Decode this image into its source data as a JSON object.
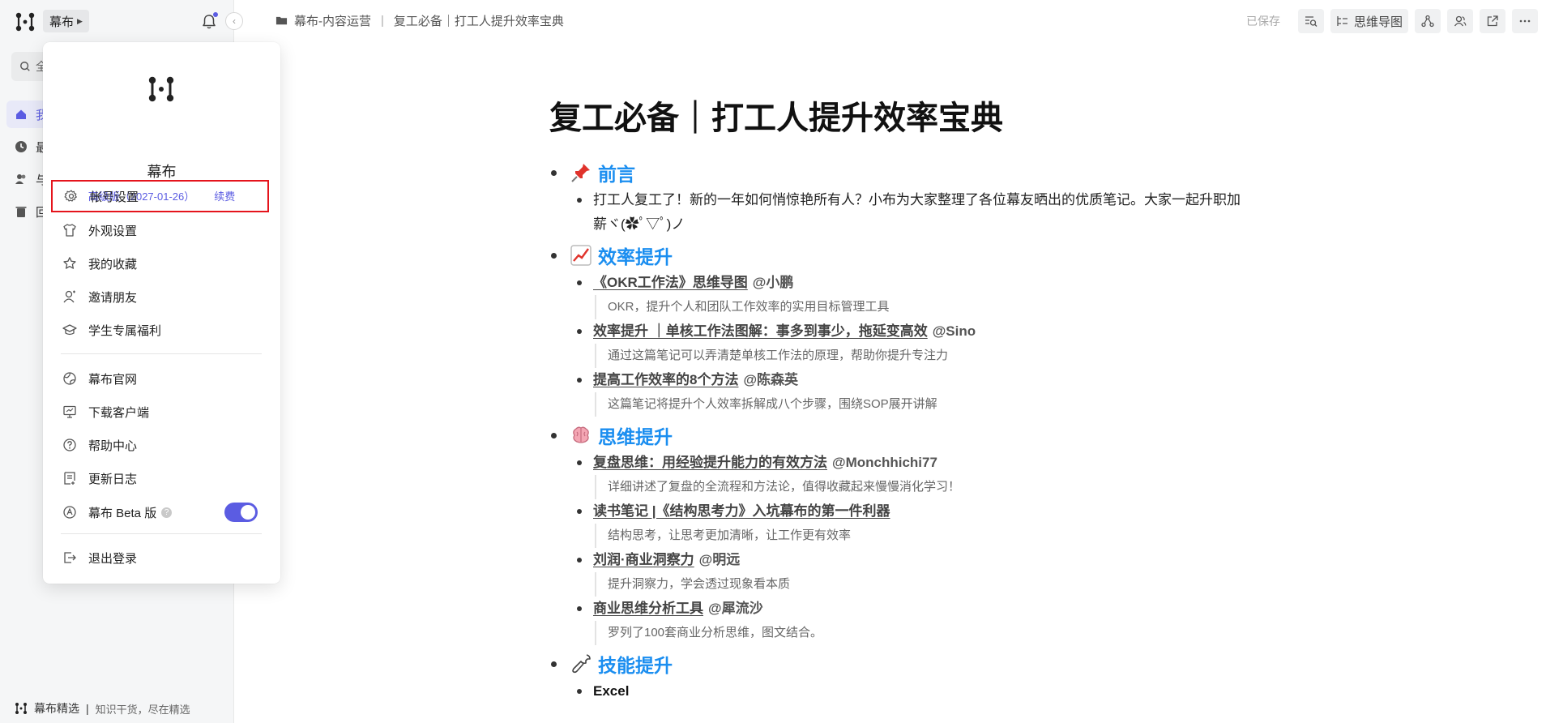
{
  "sidebar": {
    "workspace_label": "幕布",
    "search_label": "全",
    "nav": [
      {
        "label": "我"
      },
      {
        "label": "最"
      },
      {
        "label": "与"
      },
      {
        "label": "回"
      }
    ],
    "footer_brand": "幕布精选",
    "footer_tagline": "知识干货，尽在精选"
  },
  "menu": {
    "name": "幕布",
    "plan": "高级版（2027-01-26）",
    "renew": "续费",
    "items": [
      {
        "label": "帐号设置",
        "icon": "gear-icon"
      },
      {
        "label": "外观设置",
        "icon": "shirt-icon"
      },
      {
        "label": "我的收藏",
        "icon": "star-icon"
      },
      {
        "label": "邀请朋友",
        "icon": "invite-icon"
      },
      {
        "label": "学生专属福利",
        "icon": "graduation-icon"
      }
    ],
    "items2": [
      {
        "label": "幕布官网",
        "icon": "globe-icon"
      },
      {
        "label": "下载客户端",
        "icon": "monitor-icon"
      },
      {
        "label": "帮助中心",
        "icon": "help-icon"
      },
      {
        "label": "更新日志",
        "icon": "log-icon"
      },
      {
        "label": "幕布 Beta 版",
        "icon": "beta-icon"
      }
    ],
    "beta_help": "?",
    "beta_enabled": true,
    "logout": "退出登录"
  },
  "topbar": {
    "crumb_folder": "幕布-内容运营",
    "crumb_sep": "|",
    "crumb_doc": "复工必备｜打工人提升效率宝典",
    "saved": "已保存",
    "mindmap_label": "思维导图"
  },
  "doc": {
    "title": "复工必备｜打工人提升效率宝典",
    "sections": {
      "intro": {
        "heading": "前言",
        "text": "打工人复工了！新的一年如何悄惊艳所有人？小布为大家整理了各位幕友晒出的优质笔记。大家一起升职加薪ヾ(✿ﾟ▽ﾟ)ノ"
      },
      "efficiency": {
        "heading": "效率提升",
        "entries": [
          {
            "title": "《OKR工作法》思维导图",
            "author": "@小鹏",
            "note": "OKR，提升个人和团队工作效率的实用目标管理工具"
          },
          {
            "title": "效率提升 ｜单核工作法图解：事多到事少，拖延变高效",
            "author": "@Sino",
            "note": "通过这篇笔记可以弄清楚单核工作法的原理，帮助你提升专注力"
          },
          {
            "title": "提高工作效率的8个方法",
            "author": "@陈森英",
            "note": "这篇笔记将提升个人效率拆解成八个步骤，围绕SOP展开讲解"
          }
        ]
      },
      "thinking": {
        "heading": "思维提升",
        "entries": [
          {
            "title": "复盘思维：用经验提升能力的有效方法",
            "author": "@Monchhichi77",
            "note": "详细讲述了复盘的全流程和方法论，值得收藏起来慢慢消化学习！"
          },
          {
            "title": "读书笔记 |《结构思考力》入坑幕布的第一件利器",
            "author": "",
            "note": "结构思考，让思考更加清晰，让工作更有效率"
          },
          {
            "title": "刘润·商业洞察力",
            "author": "@明远",
            "note": "提升洞察力，学会透过现象看本质"
          },
          {
            "title": "商业思维分析工具",
            "author": "@犀流沙",
            "note": "罗列了100套商业分析思维，图文结合。"
          }
        ]
      },
      "skills": {
        "heading": "技能提升",
        "first_entry": "Excel"
      }
    }
  }
}
